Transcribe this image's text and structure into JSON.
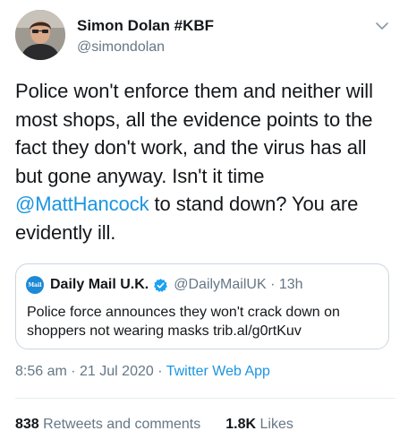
{
  "tweet": {
    "author": {
      "display_name": "Simon Dolan #KBF",
      "handle": "@simondolan"
    },
    "text_before": "Police won't enforce them and neither will most shops, all the evidence points to the fact they don't work, and the virus has all but gone anyway. Isn't it time ",
    "mention": "@MattHancock",
    "text_after": " to stand down? You are evidently ill.",
    "timestamp": "8:56 am · 21 Jul 2020 · ",
    "source": "Twitter Web App",
    "retweets_count": "838",
    "retweets_label": "Retweets and comments",
    "likes_count": "1.8K",
    "likes_label": "Likes"
  },
  "quoted_tweet": {
    "logo_text": "Mail",
    "display_name": "Daily Mail U.K.",
    "meta": "@DailyMailUK · 13h",
    "text": "Police force announces they won't crack down on shoppers not wearing masks trib.al/g0rtKuv"
  },
  "colors": {
    "link": "#1b95e0",
    "muted": "#657786",
    "verified": "#1da1f2"
  },
  "icons": [
    "chevron-down-icon",
    "verified-badge-icon"
  ]
}
